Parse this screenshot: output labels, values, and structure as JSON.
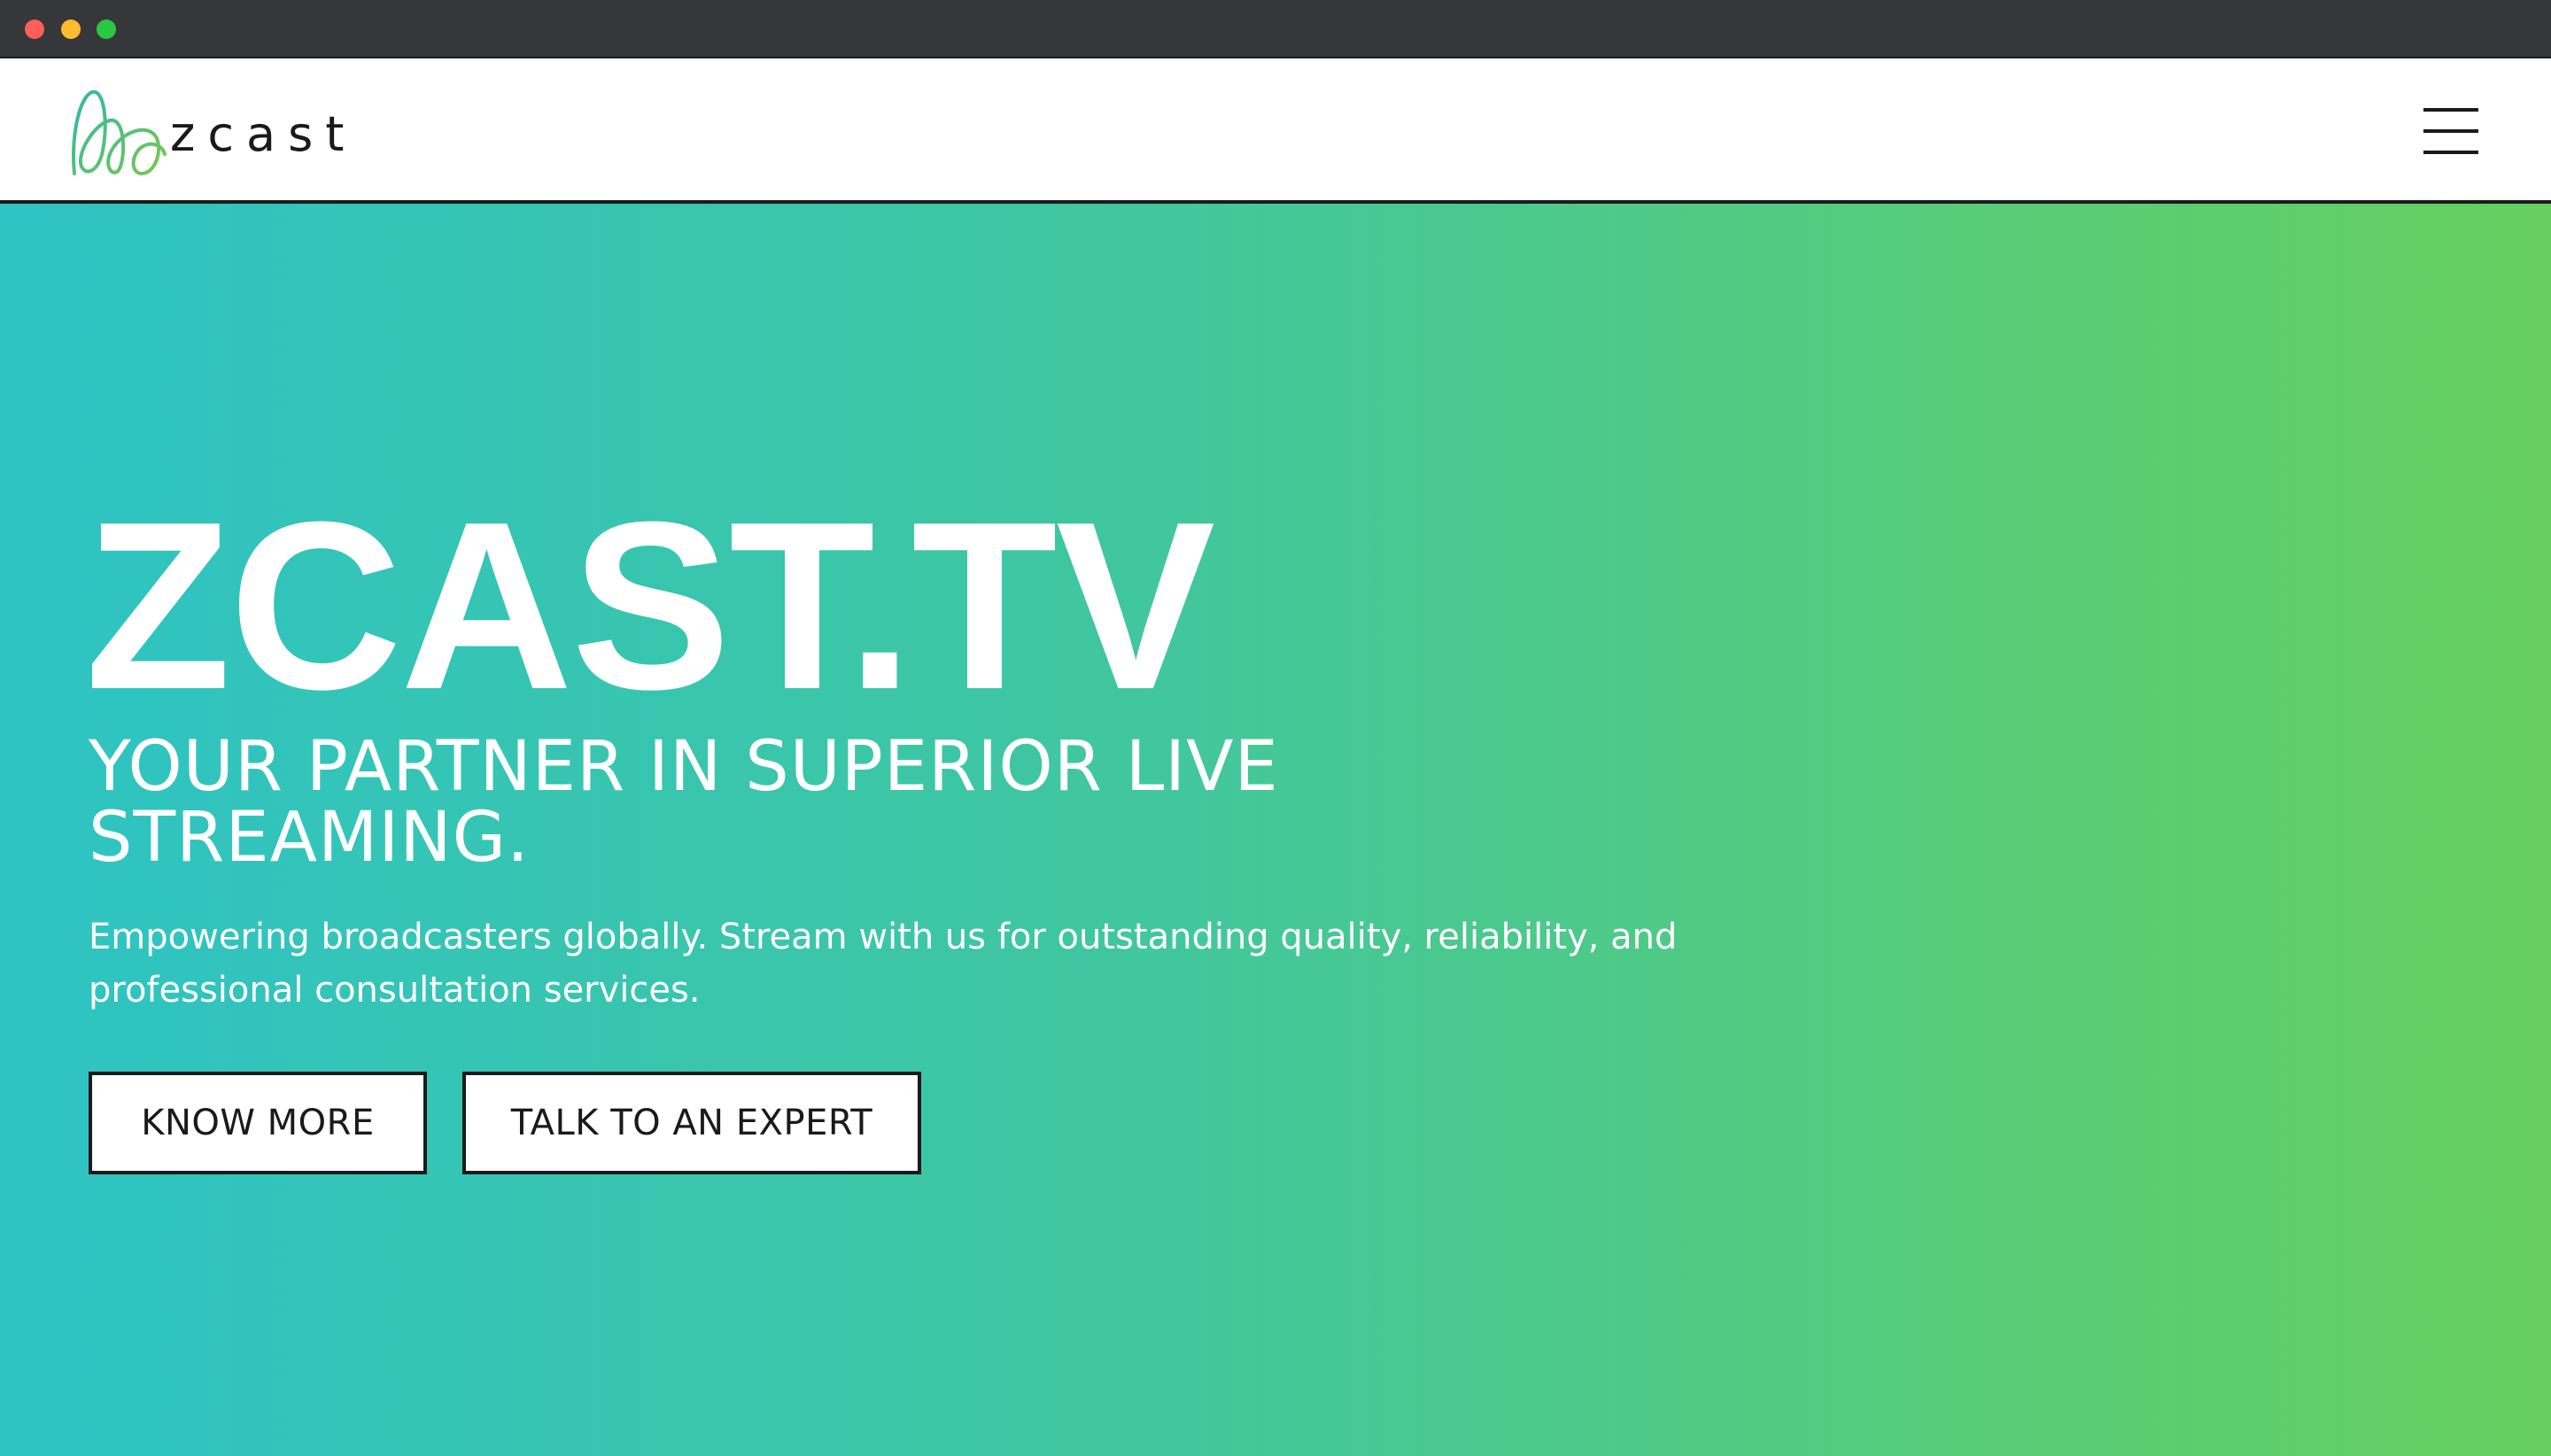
{
  "window": {
    "controls": [
      "close",
      "minimize",
      "maximize"
    ],
    "colors": {
      "close": "#fe5f57",
      "minimize": "#febc2e",
      "maximize": "#28c840"
    }
  },
  "header": {
    "logo_text": "zcast",
    "menu_icon": "hamburger-icon"
  },
  "hero": {
    "title": "ZCAST.TV",
    "subtitle": "YOUR PARTNER IN SUPERIOR LIVE STREAMING.",
    "description": "Empowering broadcasters globally. Stream with us for outstanding quality, reliability, and professional consultation services.",
    "buttons": {
      "know_more": "KNOW MORE",
      "talk_expert": "TALK TO AN EXPERT"
    },
    "gradient": {
      "from": "#2ec4c4",
      "mid": "#3ec6a3",
      "to": "#66cf5f"
    }
  },
  "brand_colors": {
    "logo_teal": "#2fb8a8",
    "logo_green": "#7ac74f"
  }
}
